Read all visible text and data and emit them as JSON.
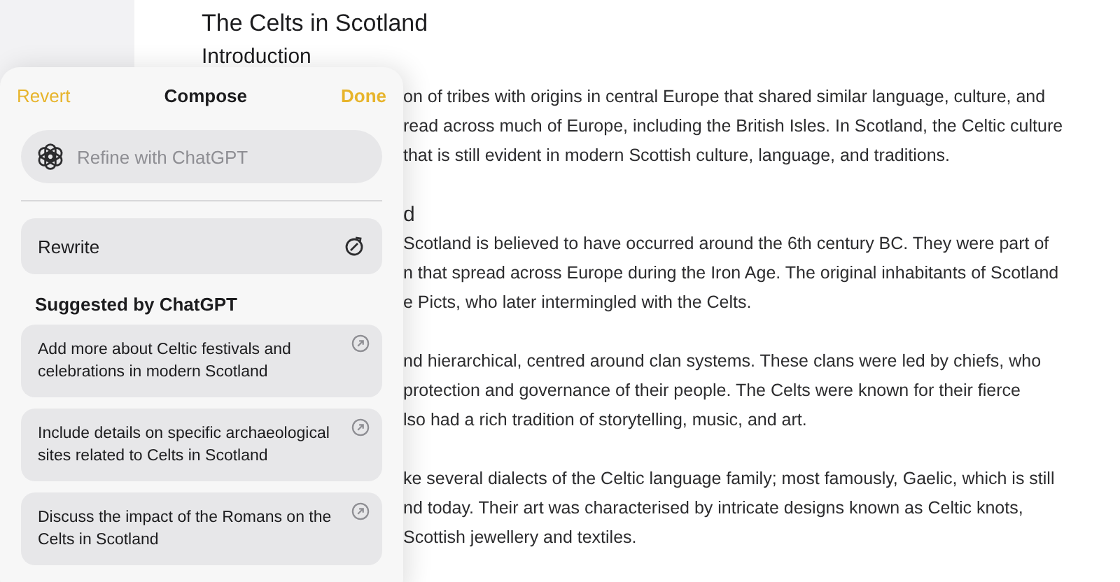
{
  "document": {
    "title": "The Celts in Scotland",
    "subtitle": "Introduction",
    "sections": [
      {
        "lines": [
          "on of tribes with origins in central Europe that shared similar language, culture, and",
          "read across much of Europe, including the British Isles. In Scotland, the Celtic culture",
          "that is still evident in modern Scottish culture, language, and traditions."
        ]
      },
      {
        "heading": "d",
        "lines": [
          "Scotland is believed to have occurred around the 6th century BC. They were part of",
          "n that spread across Europe during the Iron Age. The original inhabitants of Scotland",
          "e Picts, who later intermingled with the Celts."
        ]
      },
      {
        "lines": [
          "nd hierarchical, centred around clan systems. These clans were led by chiefs, who",
          "protection and governance of their people. The Celts were known for their fierce",
          "lso had a rich tradition of storytelling, music, and art."
        ]
      },
      {
        "lines": [
          "ke several dialects of the Celtic language family; most famously, Gaelic, which is still",
          "nd today. Their art was characterised by intricate designs known as Celtic knots,",
          "Scottish jewellery and textiles."
        ]
      }
    ]
  },
  "compose": {
    "revert": "Revert",
    "title": "Compose",
    "done": "Done",
    "refine": {
      "placeholder": "Refine with ChatGPT"
    },
    "rewrite": "Rewrite",
    "suggested_heading": "Suggested by ChatGPT",
    "suggestions": [
      "Add more about Celtic festivals and celebrations in modern Scotland",
      "Include details on specific archaeological sites related to Celts in Scotland",
      "Discuss the impact of the Romans on the Celts in Scotland"
    ]
  }
}
